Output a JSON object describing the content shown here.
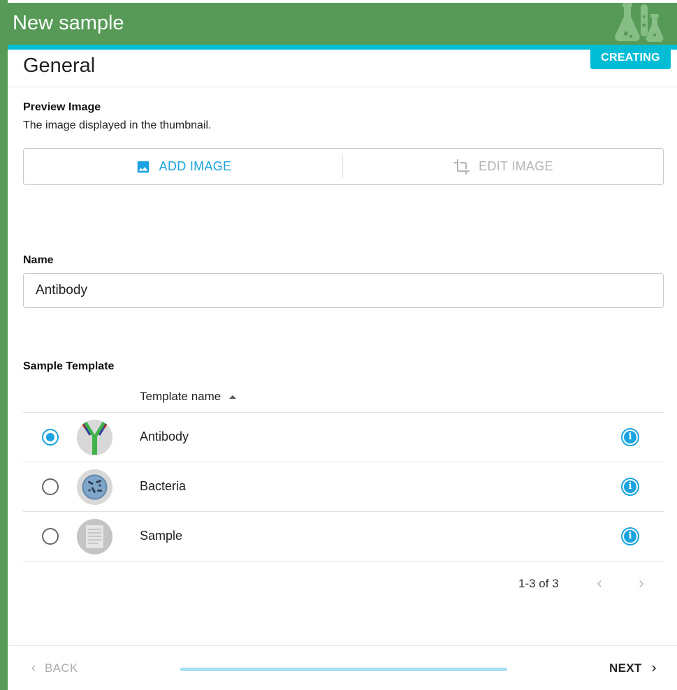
{
  "header": {
    "title": "New sample"
  },
  "status_badge": "CREATING",
  "section": {
    "title": "General"
  },
  "preview_image": {
    "label": "Preview Image",
    "help": "The image displayed in the thumbnail.",
    "add_label": "ADD IMAGE",
    "edit_label": "EDIT IMAGE"
  },
  "name_field": {
    "label": "Name",
    "value": "Antibody"
  },
  "sample_template": {
    "label": "Sample Template",
    "column_header": "Template name",
    "rows": [
      {
        "name": "Antibody",
        "selected": true,
        "thumb": "antibody"
      },
      {
        "name": "Bacteria",
        "selected": false,
        "thumb": "bacteria"
      },
      {
        "name": "Sample",
        "selected": false,
        "thumb": "document"
      }
    ],
    "pagination": "1-3 of 3"
  },
  "footer": {
    "back_label": "BACK",
    "next_label": "NEXT"
  },
  "colors": {
    "header_green": "#579a57",
    "accent_cyan": "#00bcd4",
    "primary_blue": "#1aa3e0"
  }
}
